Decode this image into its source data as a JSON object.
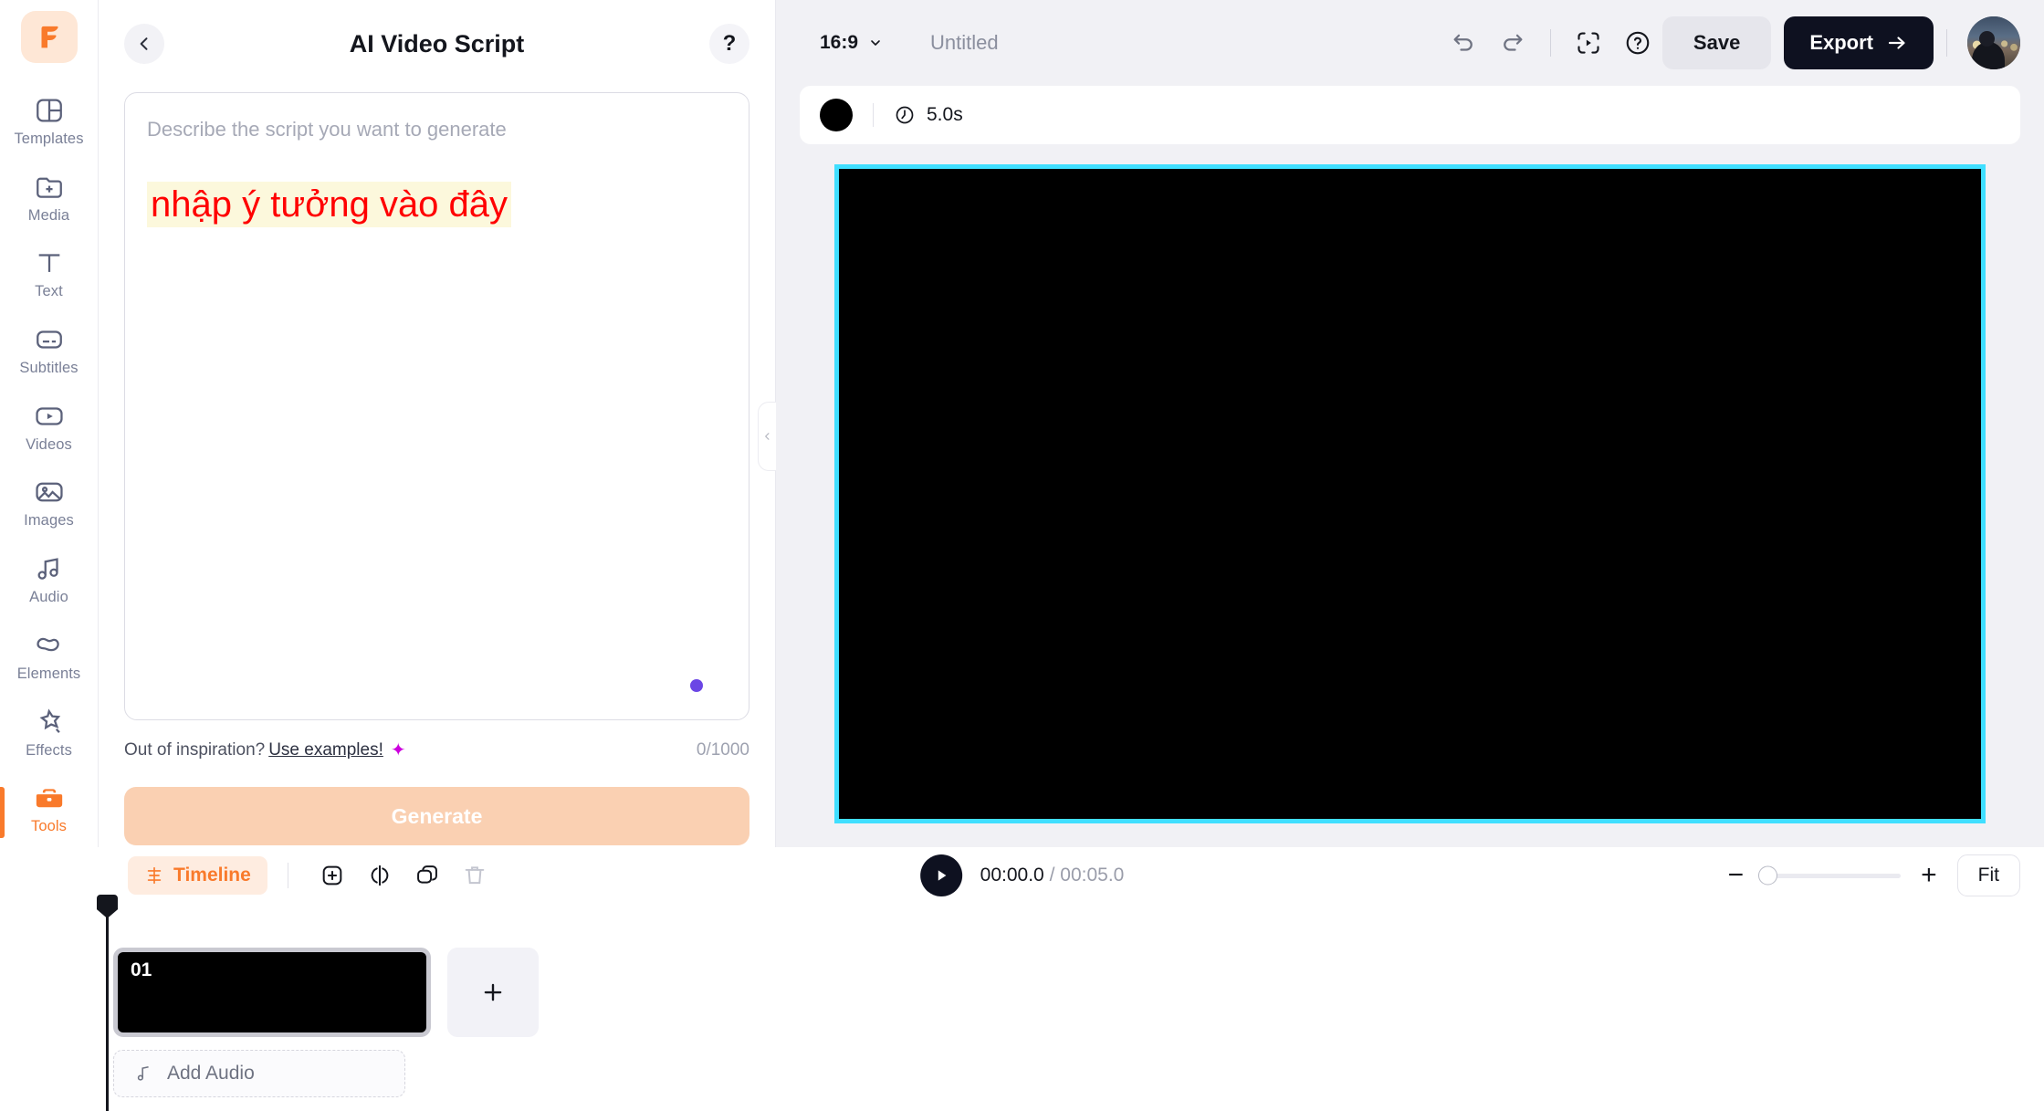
{
  "rail": {
    "logo_icon": "flexclip-f-logo",
    "items": [
      {
        "label": "Templates",
        "icon": "templates-icon",
        "active": false
      },
      {
        "label": "Media",
        "icon": "media-folder-plus-icon",
        "active": false
      },
      {
        "label": "Text",
        "icon": "text-icon",
        "active": false
      },
      {
        "label": "Subtitles",
        "icon": "subtitles-icon",
        "active": false
      },
      {
        "label": "Videos",
        "icon": "videos-play-icon",
        "active": false
      },
      {
        "label": "Images",
        "icon": "images-icon",
        "active": false
      },
      {
        "label": "Audio",
        "icon": "audio-note-icon",
        "active": false
      },
      {
        "label": "Elements",
        "icon": "elements-shapes-icon",
        "active": false
      },
      {
        "label": "Effects",
        "icon": "effects-star-icon",
        "active": false
      },
      {
        "label": "Tools",
        "icon": "tools-briefcase-icon",
        "active": true
      }
    ]
  },
  "panel": {
    "back_icon": "chevron-left-icon",
    "title": "AI Video Script",
    "help_icon": "question-mark-icon",
    "prompt_placeholder": "Describe the script you want to generate",
    "prompt_value": "",
    "annotation_text": "nhập ý tưởng vào đây",
    "annotation_color": "#FF0000",
    "annotation_highlight": "#FCF8DC",
    "inspiration_text": "Out of inspiration?",
    "examples_link": "Use examples!",
    "sparkle_icon": "sparkle-icon",
    "char_counter": "0/1000",
    "generate_label": "Generate",
    "collapse_icon": "chevron-left-icon"
  },
  "topbar": {
    "ratio": "16:9",
    "ratio_caret_icon": "chevron-down-icon",
    "doc_title": "Untitled",
    "undo_icon": "undo-icon",
    "redo_icon": "redo-icon",
    "preview_icon": "preview-play-icon",
    "help_icon": "help-circle-icon",
    "save_label": "Save",
    "export_label": "Export",
    "export_arrow_icon": "arrow-right-icon",
    "avatar_icon": "user-avatar"
  },
  "scene_bar": {
    "color_swatch": "#000000",
    "clock_icon": "clock-icon",
    "duration": "5.0s"
  },
  "preview": {
    "background": "#000000",
    "border_color": "#40DFFF"
  },
  "playbar": {
    "timeline_label": "Timeline",
    "timeline_icon": "timeline-icon",
    "add_icon": "plus-square-icon",
    "split_icon": "split-icon",
    "duplicate_icon": "duplicate-icon",
    "delete_icon": "trash-icon",
    "play_icon": "play-icon",
    "current_time": "00:00.0",
    "time_divider": "/",
    "total_time": "00:05.0",
    "zoom_out_icon": "minus-icon",
    "zoom_in_icon": "plus-icon",
    "zoom_value": 5,
    "fit_label": "Fit"
  },
  "timeline": {
    "clips": [
      {
        "number": "01",
        "selected": true
      }
    ],
    "add_scene_icon": "plus-icon",
    "audio_icon": "music-note-icon",
    "add_audio_label": "Add Audio"
  }
}
